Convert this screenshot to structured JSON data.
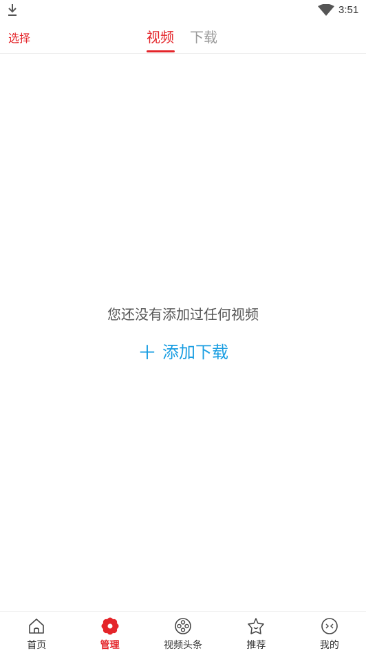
{
  "status_bar": {
    "time": "3:51",
    "icons": [
      "download-icon",
      "wifi-icon"
    ]
  },
  "header": {
    "select_label": "选择",
    "tabs": [
      {
        "label": "视频",
        "active": true
      },
      {
        "label": "下载",
        "active": false
      }
    ]
  },
  "main": {
    "empty_message": "您还没有添加过任何视频",
    "add_download_icon": "＋",
    "add_download_label": "添加下载"
  },
  "bottom_nav": {
    "items": [
      {
        "label": "首页",
        "icon": "home-icon",
        "active": false
      },
      {
        "label": "管理",
        "icon": "gear-icon",
        "active": true
      },
      {
        "label": "视频头条",
        "icon": "film-reel-icon",
        "active": false
      },
      {
        "label": "推荐",
        "icon": "star-face-icon",
        "active": false
      },
      {
        "label": "我的",
        "icon": "profile-face-icon",
        "active": false
      }
    ]
  },
  "colors": {
    "accent": "#e4252a",
    "link": "#1a9ee2",
    "inactive_tab": "#999999"
  }
}
